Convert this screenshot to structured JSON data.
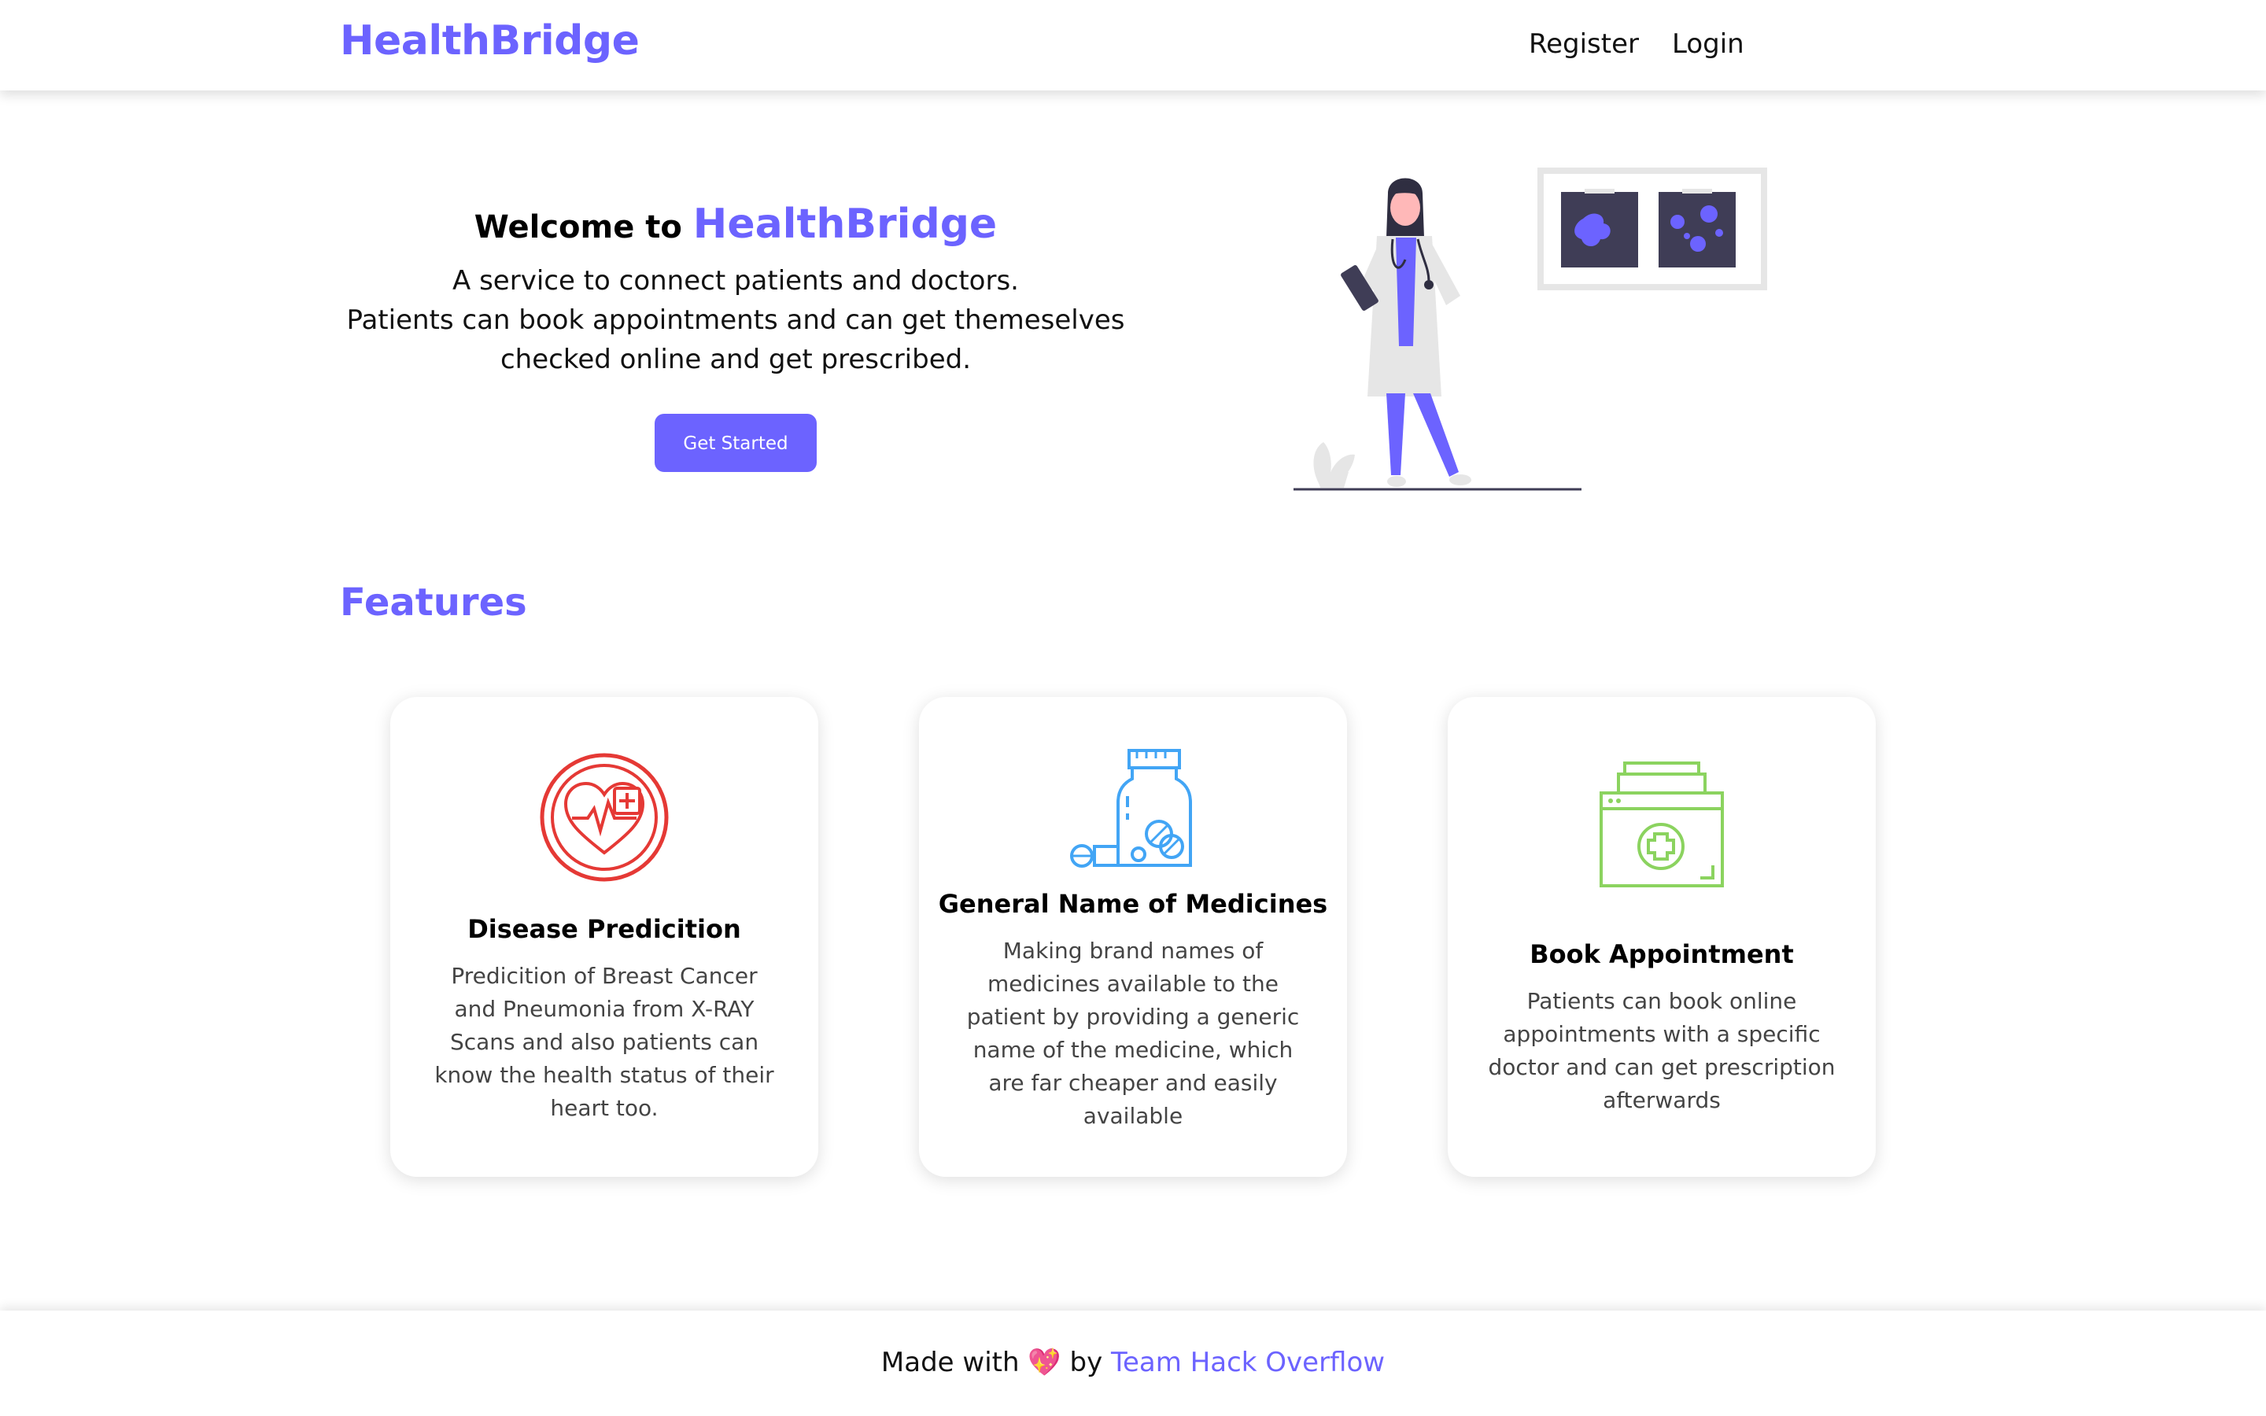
{
  "header": {
    "brand": "HealthBridge",
    "nav": {
      "register": "Register",
      "login": "Login"
    }
  },
  "hero": {
    "welcome_prefix": "Welcome to",
    "welcome_brand": "HealthBridge",
    "description_line1": "A service to connect patients and doctors.",
    "description_line2": "Patients can book appointments and can get themeselves checked online and get prescribed.",
    "cta_label": "Get Started",
    "illustration": "doctor-with-xray-illustration"
  },
  "features": {
    "title": "Features",
    "items": [
      {
        "icon": "heart-plus-icon",
        "icon_color": "#e53935",
        "title": "Disease Predicition",
        "text": "Predicition of Breast Cancer and Pneumonia from X-RAY Scans and also patients can know the health status of their heart too."
      },
      {
        "icon": "medicine-bottle-icon",
        "icon_color": "#42a5f5",
        "title": "General Name of Medicines",
        "text": "Making brand names of medicines available to the patient by providing a generic name of the medicine, which are far cheaper and easily available"
      },
      {
        "icon": "first-aid-kit-icon",
        "icon_color": "#8bd35f",
        "title": "Book Appointment",
        "text": "Patients can book online appointments with a specific doctor and can get prescription afterwards"
      }
    ]
  },
  "footer": {
    "made_with": "Made with",
    "heart": "💖",
    "by": "by",
    "team": "Team Hack Overflow"
  },
  "colors": {
    "accent": "#6c63ff",
    "dark_navy": "#3f3d56"
  }
}
